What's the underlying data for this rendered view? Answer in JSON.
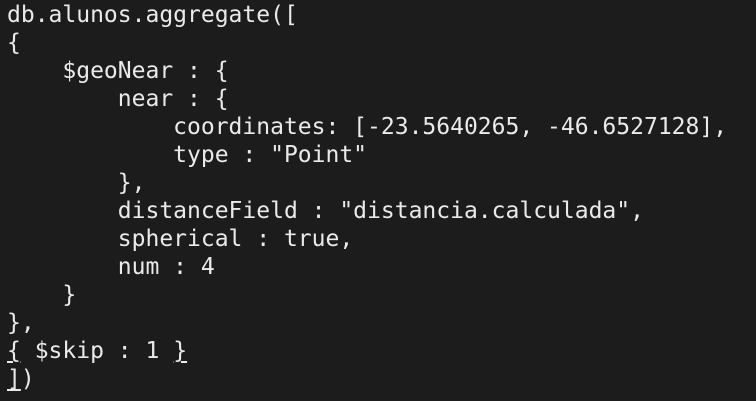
{
  "window": {
    "background": "#1c1c1c",
    "text_color": "#eaeaea"
  },
  "code_lines": [
    {
      "indent": "",
      "text": "db.alunos.aggregate(["
    },
    {
      "indent": "",
      "text": "{"
    },
    {
      "indent": "    ",
      "text": "$geoNear : {"
    },
    {
      "indent": "        ",
      "text": "near : {"
    },
    {
      "indent": "            ",
      "text": "coordinates: [-23.5640265, -46.6527128],"
    },
    {
      "indent": "            ",
      "text": "type : \"Point\""
    },
    {
      "indent": "        ",
      "text": "},"
    },
    {
      "indent": "        ",
      "text": "distanceField : \"distancia.calculada\","
    },
    {
      "indent": "        ",
      "text": "spherical : true,"
    },
    {
      "indent": "        ",
      "text": "num : 4"
    },
    {
      "indent": "    ",
      "text": "}"
    },
    {
      "indent": "",
      "text": "},"
    },
    {
      "indent": "",
      "open": "{",
      "middle": " $skip : 1 ",
      "close": "}"
    },
    {
      "indent": "",
      "open": "]",
      "middle": ")",
      "close": ""
    }
  ]
}
